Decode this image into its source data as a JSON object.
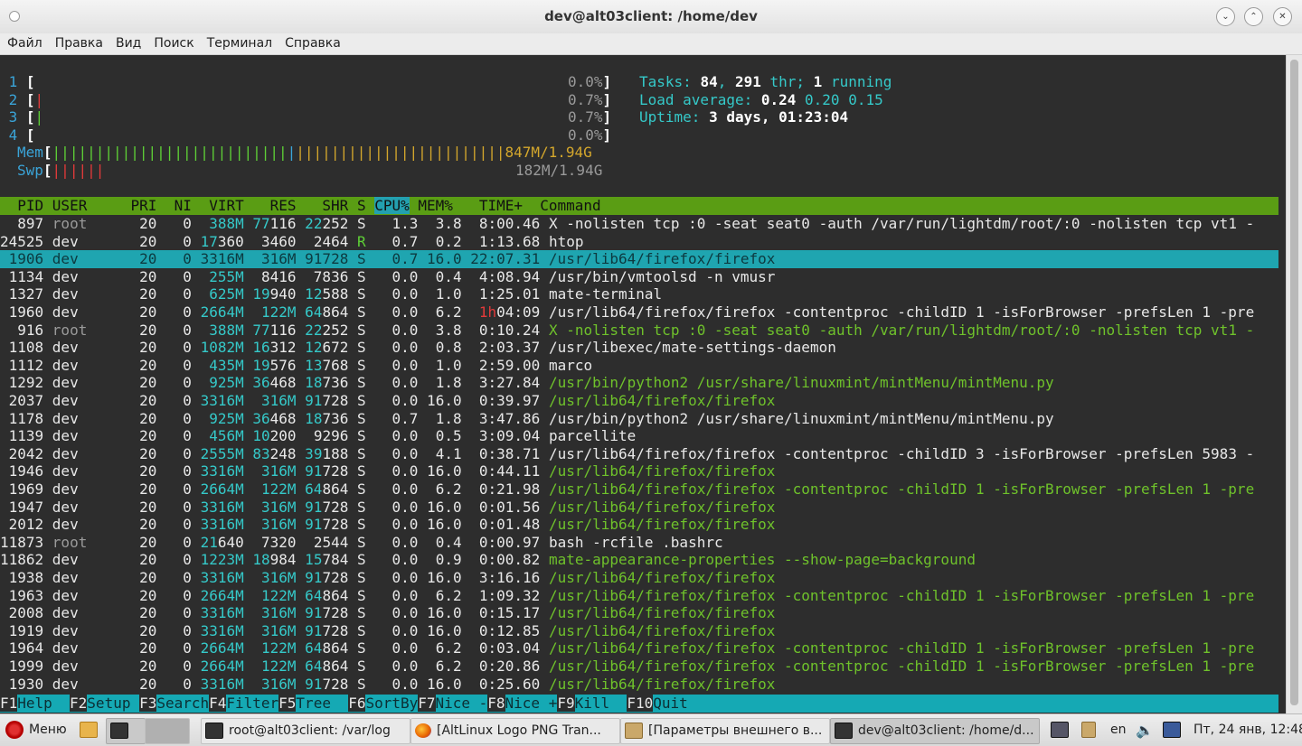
{
  "window": {
    "title": "dev@alt03client: /home/dev"
  },
  "menu": [
    "Файл",
    "Правка",
    "Вид",
    "Поиск",
    "Терминал",
    "Справка"
  ],
  "meters": {
    "cpus": [
      {
        "id": "1",
        "bar": "",
        "pct": "0.0%"
      },
      {
        "id": "2",
        "bar": "|",
        "pct": "0.7%"
      },
      {
        "id": "3",
        "bar": "|",
        "pct": "0.7%"
      },
      {
        "id": "4",
        "bar": "",
        "pct": "0.0%"
      }
    ],
    "mem": {
      "label": "Mem",
      "value": "847M/1.94G"
    },
    "swp": {
      "label": "Swp",
      "value": "182M/1.94G"
    }
  },
  "summary": {
    "tasks_label": "Tasks: ",
    "tasks": "84",
    "thr": "291",
    "thr_label": " thr; ",
    "running": "1",
    "running_label": " running",
    "load_label": "Load average: ",
    "load1": "0.24",
    "load5": "0.20",
    "load15": "0.15",
    "uptime_label": "Uptime: ",
    "uptime": "3 days, 01:23:04"
  },
  "columns": [
    "PID",
    "USER",
    "PRI",
    "NI",
    "VIRT",
    "RES",
    "SHR",
    "S",
    "CPU%",
    "MEM%",
    "TIME+",
    "Command"
  ],
  "processes": [
    {
      "pid": "897",
      "user": "root",
      "pri": "20",
      "ni": "0",
      "virt": "388M",
      "res": "77116",
      "shr": "22252",
      "s": "S",
      "cpu": "1.3",
      "mem": "3.8",
      "time": "8:00.46",
      "cmd": "X -nolisten tcp :0 -seat seat0 -auth /var/run/lightdm/root/:0 -nolisten tcp vt1 -"
    },
    {
      "pid": "24525",
      "user": "dev",
      "pri": "20",
      "ni": "0",
      "virt": "17360",
      "res": "3460",
      "shr": "2464",
      "s": "R",
      "cpu": "0.7",
      "mem": "0.2",
      "time": "1:13.68",
      "cmd": "htop"
    },
    {
      "pid": "1906",
      "user": "dev",
      "pri": "20",
      "ni": "0",
      "virt": "3316M",
      "res": "316M",
      "shr": "91728",
      "s": "S",
      "cpu": "0.7",
      "mem": "16.0",
      "time": "22:07.31",
      "cmd": "/usr/lib64/firefox/firefox"
    },
    {
      "pid": "1134",
      "user": "dev",
      "pri": "20",
      "ni": "0",
      "virt": "255M",
      "res": "8416",
      "shr": "7836",
      "s": "S",
      "cpu": "0.0",
      "mem": "0.4",
      "time": "4:08.94",
      "cmd": "/usr/bin/vmtoolsd -n vmusr"
    },
    {
      "pid": "1327",
      "user": "dev",
      "pri": "20",
      "ni": "0",
      "virt": "625M",
      "res": "19940",
      "shr": "12588",
      "s": "S",
      "cpu": "0.0",
      "mem": "1.0",
      "time": "1:25.01",
      "cmd": "mate-terminal"
    },
    {
      "pid": "1960",
      "user": "dev",
      "pri": "20",
      "ni": "0",
      "virt": "2664M",
      "res": "122M",
      "shr": "64864",
      "s": "S",
      "cpu": "0.0",
      "mem": "6.2",
      "time": "1h04:09",
      "cmd": "/usr/lib64/firefox/firefox -contentproc -childID 1 -isForBrowser -prefsLen 1 -pre"
    },
    {
      "pid": "916",
      "user": "root",
      "pri": "20",
      "ni": "0",
      "virt": "388M",
      "res": "77116",
      "shr": "22252",
      "s": "S",
      "cpu": "0.0",
      "mem": "3.8",
      "time": "0:10.24",
      "cmd": "X -nolisten tcp :0 -seat seat0 -auth /var/run/lightdm/root/:0 -nolisten tcp vt1 -"
    },
    {
      "pid": "1108",
      "user": "dev",
      "pri": "20",
      "ni": "0",
      "virt": "1082M",
      "res": "16312",
      "shr": "12672",
      "s": "S",
      "cpu": "0.0",
      "mem": "0.8",
      "time": "2:03.37",
      "cmd": "/usr/libexec/mate-settings-daemon"
    },
    {
      "pid": "1112",
      "user": "dev",
      "pri": "20",
      "ni": "0",
      "virt": "435M",
      "res": "19576",
      "shr": "13768",
      "s": "S",
      "cpu": "0.0",
      "mem": "1.0",
      "time": "2:59.00",
      "cmd": "marco"
    },
    {
      "pid": "1292",
      "user": "dev",
      "pri": "20",
      "ni": "0",
      "virt": "925M",
      "res": "36468",
      "shr": "18736",
      "s": "S",
      "cpu": "0.0",
      "mem": "1.8",
      "time": "3:27.84",
      "cmd": "/usr/bin/python2 /usr/share/linuxmint/mintMenu/mintMenu.py"
    },
    {
      "pid": "2037",
      "user": "dev",
      "pri": "20",
      "ni": "0",
      "virt": "3316M",
      "res": "316M",
      "shr": "91728",
      "s": "S",
      "cpu": "0.0",
      "mem": "16.0",
      "time": "0:39.97",
      "cmd": "/usr/lib64/firefox/firefox"
    },
    {
      "pid": "1178",
      "user": "dev",
      "pri": "20",
      "ni": "0",
      "virt": "925M",
      "res": "36468",
      "shr": "18736",
      "s": "S",
      "cpu": "0.7",
      "mem": "1.8",
      "time": "3:47.86",
      "cmd": "/usr/bin/python2 /usr/share/linuxmint/mintMenu/mintMenu.py"
    },
    {
      "pid": "1139",
      "user": "dev",
      "pri": "20",
      "ni": "0",
      "virt": "456M",
      "res": "10200",
      "shr": "9296",
      "s": "S",
      "cpu": "0.0",
      "mem": "0.5",
      "time": "3:09.04",
      "cmd": "parcellite"
    },
    {
      "pid": "2042",
      "user": "dev",
      "pri": "20",
      "ni": "0",
      "virt": "2555M",
      "res": "83248",
      "shr": "39188",
      "s": "S",
      "cpu": "0.0",
      "mem": "4.1",
      "time": "0:38.71",
      "cmd": "/usr/lib64/firefox/firefox -contentproc -childID 3 -isForBrowser -prefsLen 5983 -"
    },
    {
      "pid": "1946",
      "user": "dev",
      "pri": "20",
      "ni": "0",
      "virt": "3316M",
      "res": "316M",
      "shr": "91728",
      "s": "S",
      "cpu": "0.0",
      "mem": "16.0",
      "time": "0:44.11",
      "cmd": "/usr/lib64/firefox/firefox"
    },
    {
      "pid": "1969",
      "user": "dev",
      "pri": "20",
      "ni": "0",
      "virt": "2664M",
      "res": "122M",
      "shr": "64864",
      "s": "S",
      "cpu": "0.0",
      "mem": "6.2",
      "time": "0:21.98",
      "cmd": "/usr/lib64/firefox/firefox -contentproc -childID 1 -isForBrowser -prefsLen 1 -pre"
    },
    {
      "pid": "1947",
      "user": "dev",
      "pri": "20",
      "ni": "0",
      "virt": "3316M",
      "res": "316M",
      "shr": "91728",
      "s": "S",
      "cpu": "0.0",
      "mem": "16.0",
      "time": "0:01.56",
      "cmd": "/usr/lib64/firefox/firefox"
    },
    {
      "pid": "2012",
      "user": "dev",
      "pri": "20",
      "ni": "0",
      "virt": "3316M",
      "res": "316M",
      "shr": "91728",
      "s": "S",
      "cpu": "0.0",
      "mem": "16.0",
      "time": "0:01.48",
      "cmd": "/usr/lib64/firefox/firefox"
    },
    {
      "pid": "11873",
      "user": "root",
      "pri": "20",
      "ni": "0",
      "virt": "21640",
      "res": "7320",
      "shr": "2544",
      "s": "S",
      "cpu": "0.0",
      "mem": "0.4",
      "time": "0:00.97",
      "cmd": "bash -rcfile .bashrc"
    },
    {
      "pid": "11862",
      "user": "dev",
      "pri": "20",
      "ni": "0",
      "virt": "1223M",
      "res": "18984",
      "shr": "15784",
      "s": "S",
      "cpu": "0.0",
      "mem": "0.9",
      "time": "0:00.82",
      "cmd": "mate-appearance-properties --show-page=background"
    },
    {
      "pid": "1938",
      "user": "dev",
      "pri": "20",
      "ni": "0",
      "virt": "3316M",
      "res": "316M",
      "shr": "91728",
      "s": "S",
      "cpu": "0.0",
      "mem": "16.0",
      "time": "3:16.16",
      "cmd": "/usr/lib64/firefox/firefox"
    },
    {
      "pid": "1963",
      "user": "dev",
      "pri": "20",
      "ni": "0",
      "virt": "2664M",
      "res": "122M",
      "shr": "64864",
      "s": "S",
      "cpu": "0.0",
      "mem": "6.2",
      "time": "1:09.32",
      "cmd": "/usr/lib64/firefox/firefox -contentproc -childID 1 -isForBrowser -prefsLen 1 -pre"
    },
    {
      "pid": "2008",
      "user": "dev",
      "pri": "20",
      "ni": "0",
      "virt": "3316M",
      "res": "316M",
      "shr": "91728",
      "s": "S",
      "cpu": "0.0",
      "mem": "16.0",
      "time": "0:15.17",
      "cmd": "/usr/lib64/firefox/firefox"
    },
    {
      "pid": "1919",
      "user": "dev",
      "pri": "20",
      "ni": "0",
      "virt": "3316M",
      "res": "316M",
      "shr": "91728",
      "s": "S",
      "cpu": "0.0",
      "mem": "16.0",
      "time": "0:12.85",
      "cmd": "/usr/lib64/firefox/firefox"
    },
    {
      "pid": "1964",
      "user": "dev",
      "pri": "20",
      "ni": "0",
      "virt": "2664M",
      "res": "122M",
      "shr": "64864",
      "s": "S",
      "cpu": "0.0",
      "mem": "6.2",
      "time": "0:03.04",
      "cmd": "/usr/lib64/firefox/firefox -contentproc -childID 1 -isForBrowser -prefsLen 1 -pre"
    },
    {
      "pid": "1999",
      "user": "dev",
      "pri": "20",
      "ni": "0",
      "virt": "2664M",
      "res": "122M",
      "shr": "64864",
      "s": "S",
      "cpu": "0.0",
      "mem": "6.2",
      "time": "0:20.86",
      "cmd": "/usr/lib64/firefox/firefox -contentproc -childID 1 -isForBrowser -prefsLen 1 -pre"
    },
    {
      "pid": "1930",
      "user": "dev",
      "pri": "20",
      "ni": "0",
      "virt": "3316M",
      "res": "316M",
      "shr": "91728",
      "s": "S",
      "cpu": "0.0",
      "mem": "16.0",
      "time": "0:25.60",
      "cmd": "/usr/lib64/firefox/firefox"
    }
  ],
  "fkeys": [
    {
      "key": "F1",
      "label": "Help  "
    },
    {
      "key": "F2",
      "label": "Setup "
    },
    {
      "key": "F3",
      "label": "Search"
    },
    {
      "key": "F4",
      "label": "Filter"
    },
    {
      "key": "F5",
      "label": "Tree  "
    },
    {
      "key": "F6",
      "label": "SortBy"
    },
    {
      "key": "F7",
      "label": "Nice -"
    },
    {
      "key": "F8",
      "label": "Nice +"
    },
    {
      "key": "F9",
      "label": "Kill  "
    },
    {
      "key": "F10",
      "label": "Quit  "
    }
  ],
  "taskbar": {
    "menu_label": "Меню",
    "windows": [
      {
        "title": "root@alt03client: /var/log",
        "icon": "terminal-icon"
      },
      {
        "title": "[AltLinux Logo PNG Tran...",
        "icon": "firefox-icon"
      },
      {
        "title": "[Параметры внешнего в...",
        "icon": "preferences-icon"
      },
      {
        "title": "dev@alt03client: /home/d...",
        "icon": "terminal-icon"
      }
    ],
    "lang": "en",
    "clock": "Пт, 24 янв, 12:48"
  }
}
